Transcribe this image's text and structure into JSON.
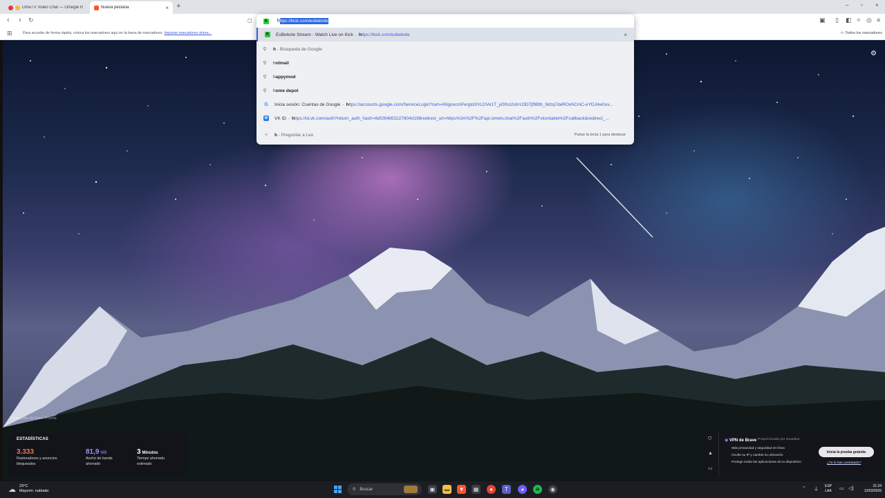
{
  "tabs": [
    {
      "title": "OmeTV Video Chat — Omegle R",
      "close": "×"
    },
    {
      "title": "Nueva pestaña",
      "close": "×"
    }
  ],
  "new_tab": "+",
  "window_controls": {
    "minimize": "–",
    "maximize": "▫",
    "close": "×"
  },
  "omnibox": {
    "typed_prefix": "h",
    "selected_completion": "ttps://kick.com/esbebote",
    "suggestions": [
      {
        "kind": "kick",
        "title": "EsBebote Stream - Watch Live on Kick",
        "sep": "-",
        "url_prefix": "h",
        "url_rest": "ttps://kick.com/esbebote",
        "remove": "×"
      },
      {
        "kind": "search",
        "query": "h",
        "desc": "- Búsqueda de Google"
      },
      {
        "kind": "history",
        "prefix": "h",
        "rest": "otmail"
      },
      {
        "kind": "history",
        "prefix": "h",
        "rest": "appymod"
      },
      {
        "kind": "history",
        "prefix": "h",
        "rest": "ome depot"
      },
      {
        "kind": "google",
        "title": "Inicia sesión: Cuentas de Google",
        "sep": "-",
        "url_prefix": "h",
        "url_rest": "ttps://accounts.google.com/ServiceLogin?rart=ANgoxcmPergtdXVLDVe1T_yGfno2shrU3D7jf9Btb_9dzq7deROvhCmC-eYDJ4w0uv..."
      },
      {
        "kind": "vk",
        "title": "VK ID",
        "sep": "-",
        "url_prefix": "h",
        "url_rest": "ttps://id.vk.com/auth?return_auth_hash=8df264b53227804d198redirect_uri=https%3A%2F%2Fapi.ometv.chat%2Fauth%2Fvkontakte%2Fcallback&redirect_..."
      },
      {
        "kind": "leo",
        "prefix": "h",
        "rest": "- Preguntar a Leo",
        "hint": "Pulsar la tecla 1 para destacar"
      }
    ]
  },
  "bookmarks_bar": {
    "hint": "Para acceder de forma rápida, coloca los marcadores aquí en la barra de marcadores.",
    "import_link": "Importar marcadores ahora...",
    "all_bookmarks": "Todos los marcadores"
  },
  "wallpaper": {
    "credit": "Fotografía de Dave Pineda"
  },
  "stats": {
    "header": "ESTADÍSTICAS",
    "trackers": {
      "value": "3.333",
      "label_1": "Rastreadores y anuncios",
      "label_2": "bloqueados",
      "color": "#ff6a4b"
    },
    "bandwidth": {
      "value": "81,9",
      "unit": "MB",
      "label_1": "Ancho de banda",
      "label_2": "ahorrado",
      "color": "#a78bfa"
    },
    "time": {
      "value": "3",
      "unit": "Minutos",
      "label_1": "Tiempo ahorrado",
      "label_2": "estimado",
      "color": "#ffffff"
    }
  },
  "vpn": {
    "title": "VPN de Brave",
    "powered": "Proporcionado por Guardian",
    "features": [
      "Más privacidad y seguridad en línea",
      "Oculte su IP y cambie su ubicación",
      "Protege todas las aplicaciones de tu dispositivo"
    ],
    "cta": "Inicia la prueba gratuita",
    "link": "¿Ya lo has contratado?"
  },
  "taskbar": {
    "weather_temp": "23°C",
    "weather_desc": "Mayorm. nublado",
    "search_placeholder": "Buscar",
    "lang_1": "ESP",
    "lang_2": "LAA",
    "time": "21:24",
    "date": "12/03/2026"
  },
  "colors": {
    "kick": "#2bd13c",
    "accent": "#3b5bdb",
    "brave": "#fb542b"
  }
}
